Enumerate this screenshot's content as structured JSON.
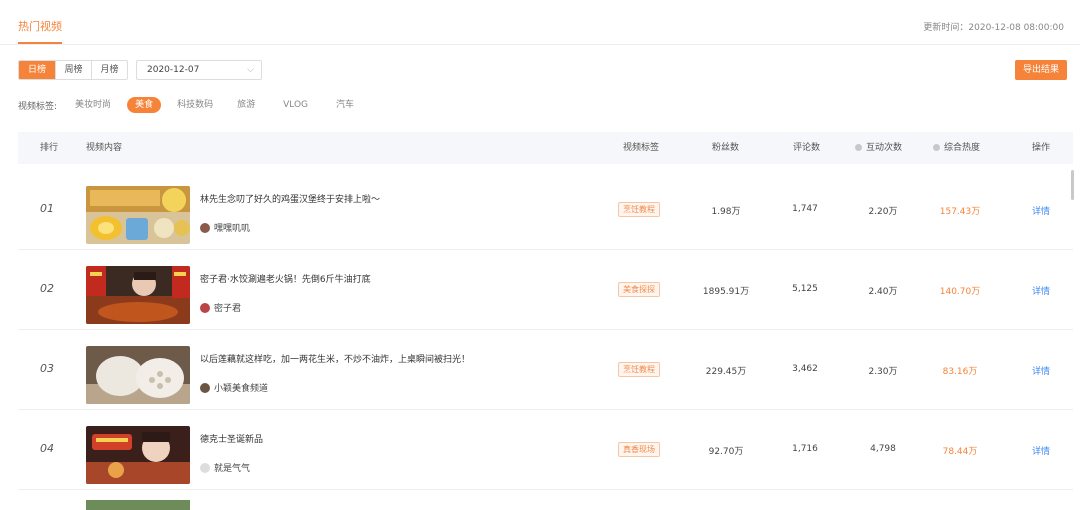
{
  "header": {
    "tab_label": "热门视频",
    "update_label": "更新时间：2020-12-08 08:00:00"
  },
  "filters": {
    "period_buttons": [
      "日榜",
      "周榜",
      "月榜"
    ],
    "active_period": "日榜",
    "date_value": "2020-12-07",
    "export_label": "导出结果",
    "tags_label": "视频标签:",
    "tags": [
      "美妆时尚",
      "美食",
      "科技数码",
      "旅游",
      "VLOG",
      "汽车"
    ],
    "active_tag": "美食"
  },
  "table": {
    "headers": {
      "rank": "排行",
      "content": "视频内容",
      "tag": "视频标签",
      "fans": "粉丝数",
      "comments": "评论数",
      "interactions": "互动次数",
      "heat": "综合热度",
      "action": "操作"
    },
    "rows": [
      {
        "rank": "01",
        "title": "林先生念叨了好久的鸡蛋汉堡终于安排上啦～",
        "author": "嘿嘿叽叽",
        "tag": "烹饪教程",
        "fans": "1.98万",
        "comments": "1,747",
        "interactions": "2.20万",
        "heat": "157.43万",
        "action": "详情"
      },
      {
        "rank": "02",
        "title": "密子君·水饺涮遍老火锅！先倒6斤牛油打底",
        "author": "密子君",
        "tag": "美食探探",
        "fans": "1895.91万",
        "comments": "5,125",
        "interactions": "2.40万",
        "heat": "140.70万",
        "action": "详情"
      },
      {
        "rank": "03",
        "title": "以后莲藕就这样吃，加一两花生米，不炒不油炸，上桌瞬间被扫光！",
        "author": "小颖美食频道",
        "tag": "烹饪教程",
        "fans": "229.45万",
        "comments": "3,462",
        "interactions": "2.30万",
        "heat": "83.16万",
        "action": "详情"
      },
      {
        "rank": "04",
        "title": "德克士圣诞新品",
        "author": "就是气气",
        "tag": "真香现场",
        "fans": "92.70万",
        "comments": "1,716",
        "interactions": "4,798",
        "heat": "78.44万",
        "action": "详情"
      }
    ]
  },
  "thumb_icons": [
    "burger-food-thumbnail",
    "hotpot-thumbnail",
    "lotus-root-thumbnail",
    "christmas-food-thumbnail"
  ],
  "colors": {
    "accent": "#f5843a",
    "link": "#3d8af7"
  }
}
